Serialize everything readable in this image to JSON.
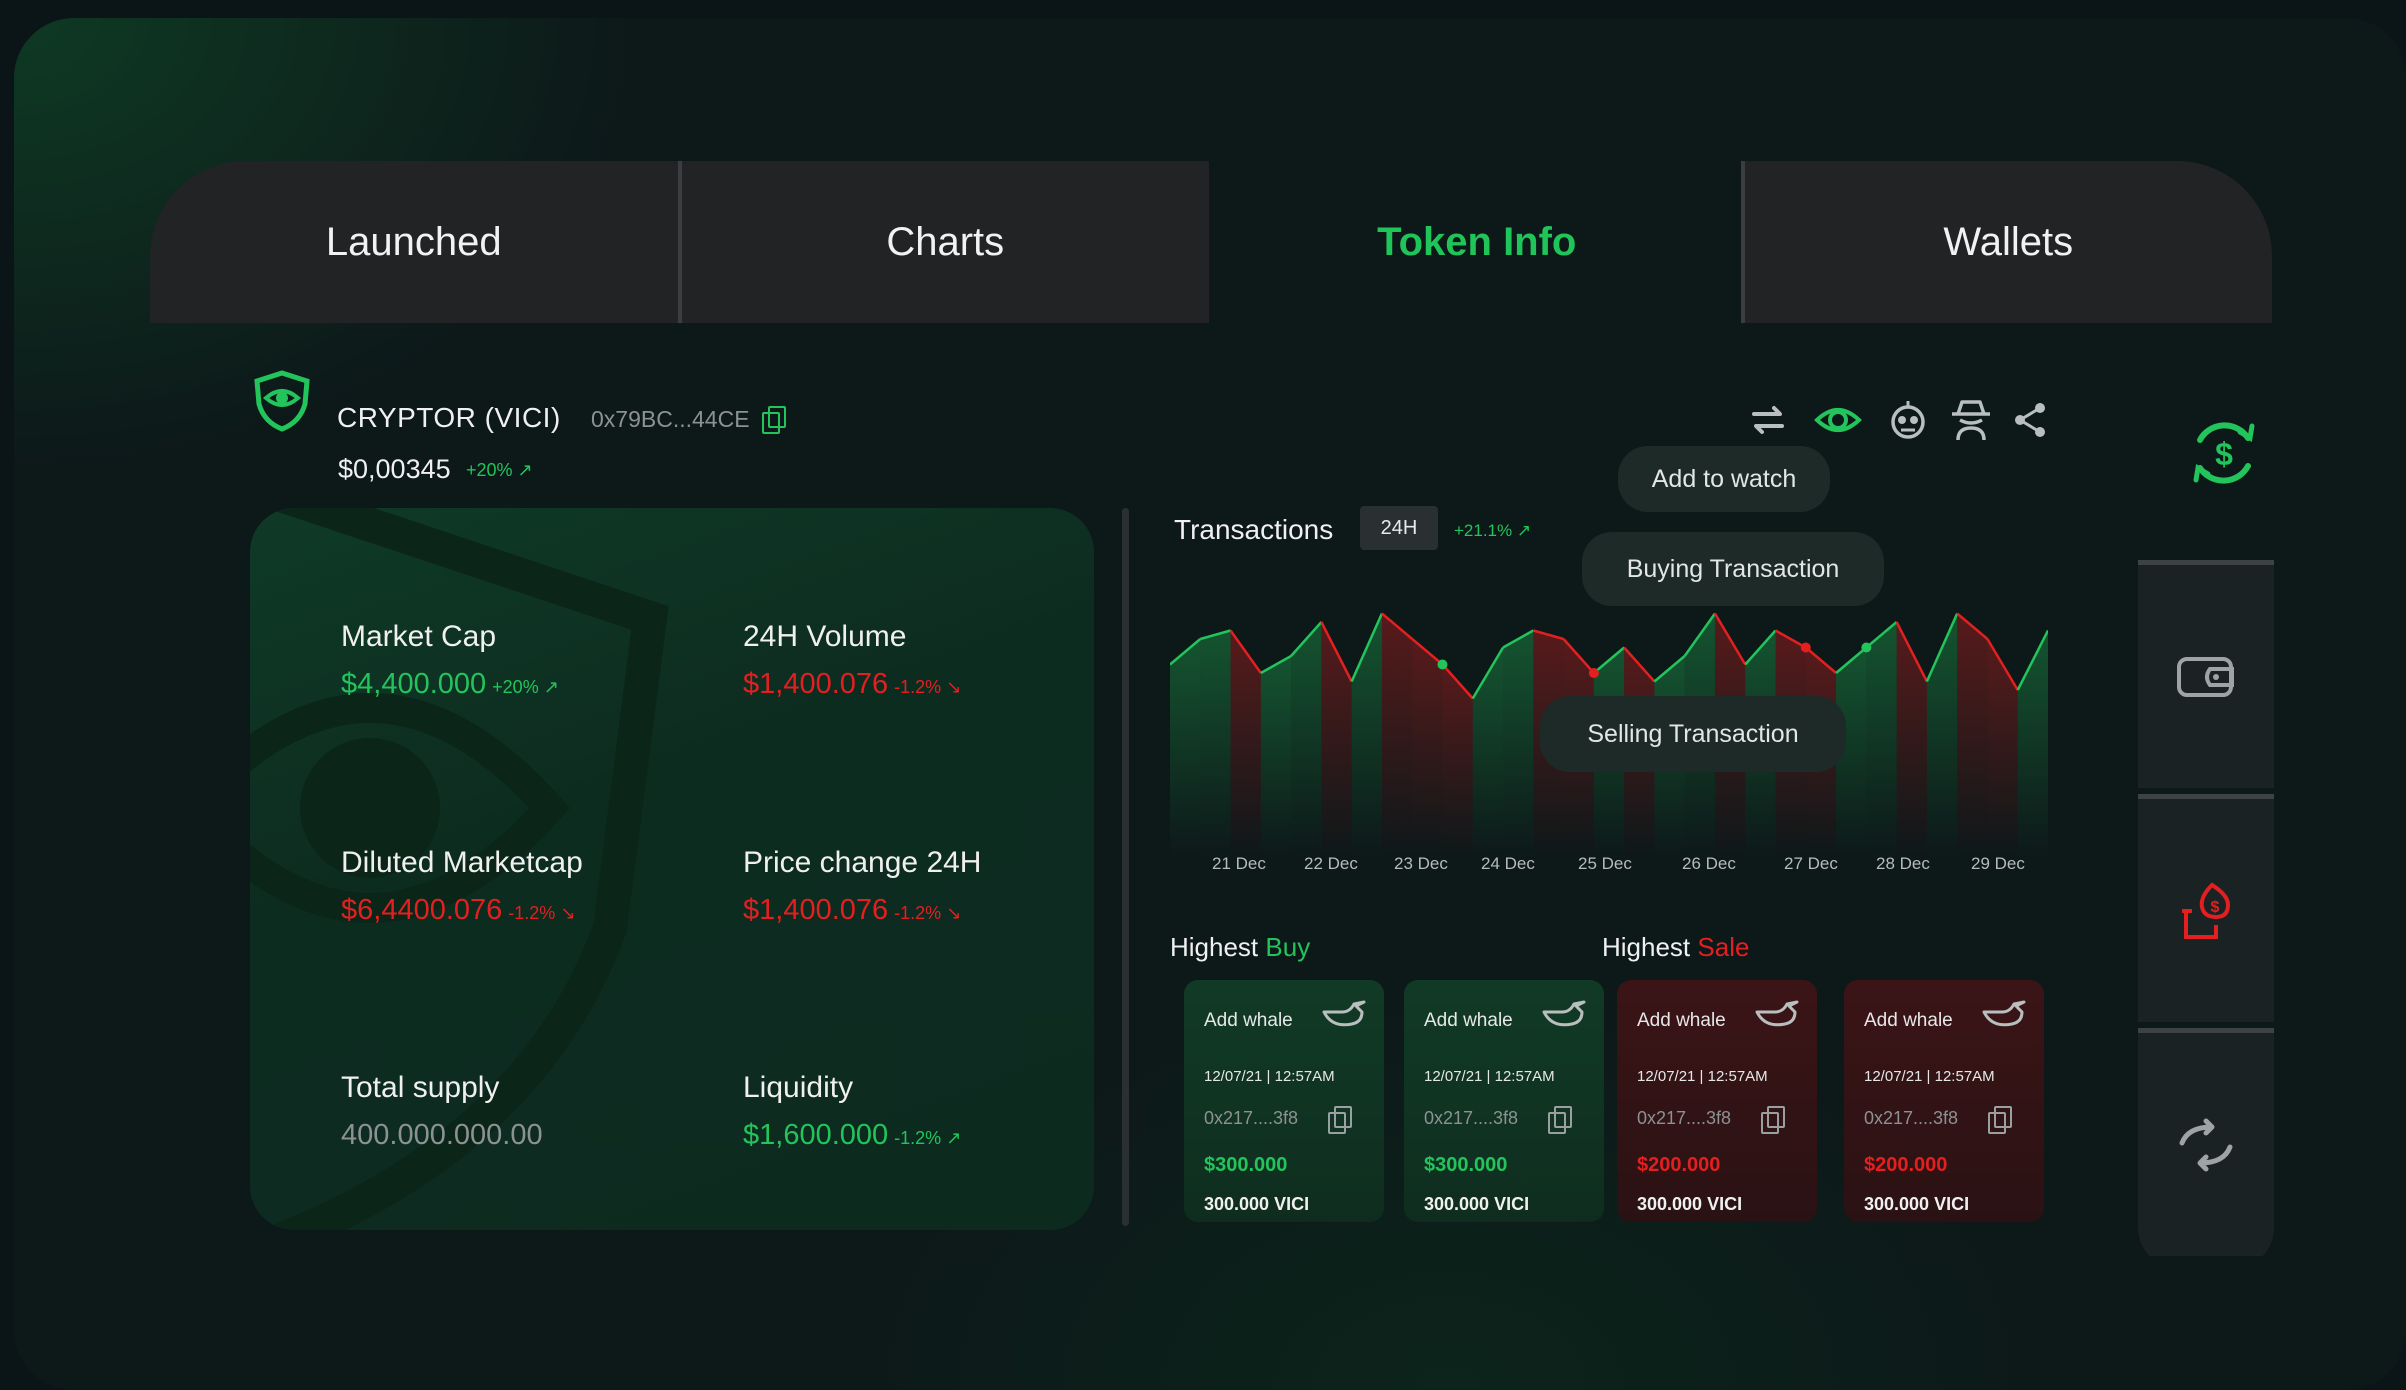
{
  "tabs": [
    {
      "label": "Launched"
    },
    {
      "label": "Charts"
    },
    {
      "label": "Token Info"
    },
    {
      "label": "Wallets"
    }
  ],
  "active_tab": "Token Info",
  "token": {
    "name": "CRYPTOR (VICI)",
    "address": "0x79BC...44CE",
    "price": "$0,00345",
    "change": "+20%"
  },
  "toolbar": {
    "icons": [
      "swap-icon",
      "eye-icon",
      "robot-icon",
      "spy-icon",
      "share-icon"
    ]
  },
  "tooltips": {
    "watch": "Add to watch",
    "buying": "Buying Transaction",
    "selling": "Selling Transaction"
  },
  "stats": [
    {
      "label": "Market Cap",
      "value": "$4,400.000",
      "change": "+20%",
      "trend": "up",
      "color": "#22c45b"
    },
    {
      "label": "24H Volume",
      "value": "$1,400.076",
      "change": "-1.2%",
      "trend": "down",
      "color": "#e41f1f"
    },
    {
      "label": "Diluted Marketcap",
      "value": "$6,4400.076",
      "change": "-1.2%",
      "trend": "down",
      "color": "#e41f1f"
    },
    {
      "label": "Price change 24H",
      "value": "$1,400.076",
      "change": "-1.2%",
      "trend": "down",
      "color": "#e41f1f"
    },
    {
      "label": "Total supply",
      "value": "400.000.000.00",
      "change": "",
      "trend": "",
      "color": "#8c9294"
    },
    {
      "label": "Liquidity",
      "value": "$1,600.000",
      "change": "-1.2%",
      "trend": "up",
      "color": "#22c45b"
    }
  ],
  "transactions": {
    "title": "Transactions",
    "timeframe": "24H",
    "change": "+21.1%"
  },
  "chart_data": {
    "type": "line",
    "x": [
      "21 Dec",
      "22 Dec",
      "23 Dec",
      "24 Dec",
      "25 Dec",
      "26 Dec",
      "27 Dec",
      "28 Dec",
      "29 Dec"
    ],
    "series": [
      {
        "values": [
          52,
          58,
          60,
          50,
          54,
          62,
          48,
          64,
          58,
          52,
          44,
          56,
          60,
          58,
          50,
          56,
          48,
          54,
          64,
          52,
          60,
          56,
          50,
          56,
          62,
          48,
          64,
          58,
          46,
          60
        ]
      }
    ],
    "buy_color": "#22c45b",
    "sell_color": "#e41f1f"
  },
  "highest": {
    "label": "Highest",
    "buy": "Buy",
    "sale": "Sale"
  },
  "cards": [
    {
      "type": "buy",
      "add": "Add whale",
      "date": "12/07/21 | 12:57AM",
      "addr": "0x217....3f8",
      "usd": "$300.000",
      "vici": "300.000 VICI"
    },
    {
      "type": "buy",
      "add": "Add whale",
      "date": "12/07/21 | 12:57AM",
      "addr": "0x217....3f8",
      "usd": "$300.000",
      "vici": "300.000 VICI"
    },
    {
      "type": "sell",
      "add": "Add whale",
      "date": "12/07/21 | 12:57AM",
      "addr": "0x217....3f8",
      "usd": "$200.000",
      "vici": "300.000 VICI"
    },
    {
      "type": "sell",
      "add": "Add whale",
      "date": "12/07/21 | 12:57AM",
      "addr": "0x217....3f8",
      "usd": "$200.000",
      "vici": "300.000 VICI"
    }
  ],
  "sidebar": {
    "top_icon": "dollar-refresh-icon",
    "items": [
      "wallet-icon",
      "fire-dollar-icon",
      "swap-arrows-icon"
    ]
  }
}
